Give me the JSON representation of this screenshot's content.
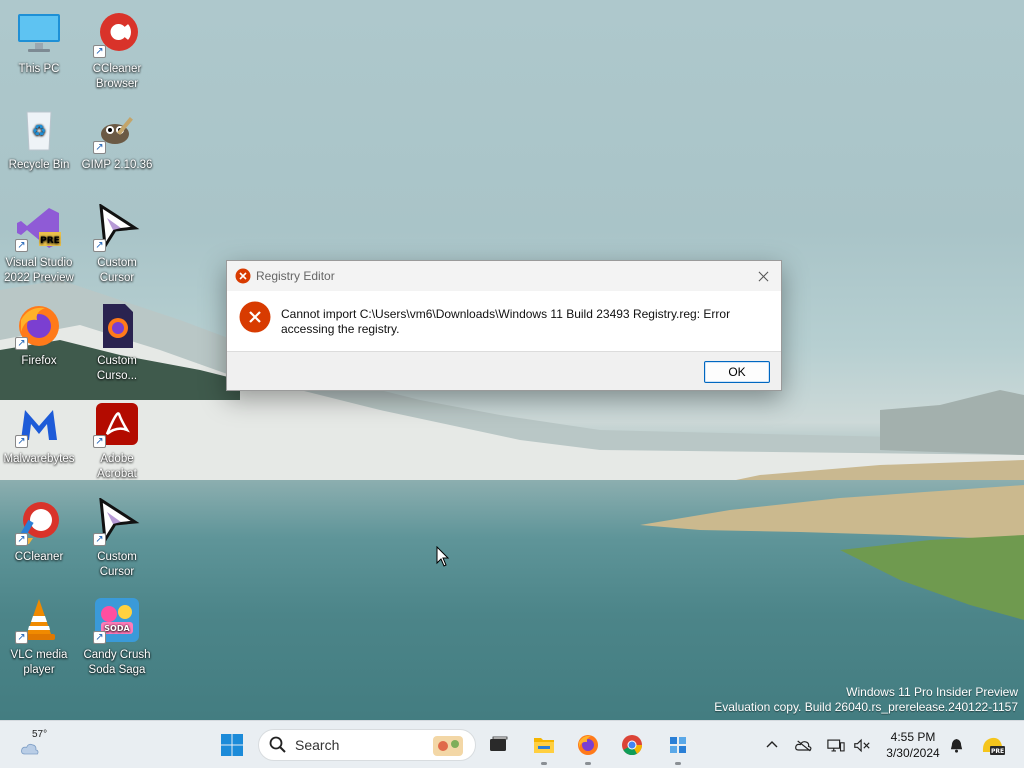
{
  "desktop": {
    "icons": [
      {
        "label": "This PC"
      },
      {
        "label": "CCleaner\nBrowser"
      },
      {
        "label": "Recycle Bin"
      },
      {
        "label": "GIMP 2.10.36"
      },
      {
        "label": "Visual Studio\n2022 Preview"
      },
      {
        "label": "Custom\nCursor"
      },
      {
        "label": "Firefox"
      },
      {
        "label": "Custom\nCurso..."
      },
      {
        "label": "Malwarebytes"
      },
      {
        "label": "Adobe\nAcrobat"
      },
      {
        "label": "CCleaner"
      },
      {
        "label": "Custom\nCursor"
      },
      {
        "label": "VLC media\nplayer"
      },
      {
        "label": "Candy Crush\nSoda Saga"
      }
    ]
  },
  "dialog": {
    "title": "Registry Editor",
    "message": "Cannot import C:\\Users\\vm6\\Downloads\\Windows 11 Build 23493 Registry.reg: Error accessing the registry.",
    "ok_label": "OK"
  },
  "watermark": {
    "line1": "Windows 11 Pro Insider Preview",
    "line2": "Evaluation copy. Build 26040.rs_prerelease.240122-1157"
  },
  "taskbar": {
    "weather_temp": "57°",
    "search_placeholder": "Search",
    "clock_time": "4:55 PM",
    "clock_date": "3/30/2024"
  },
  "colors": {
    "accent": "#0067c0",
    "error_red": "#d83b01",
    "taskbar_bg": "#e9eef2"
  }
}
